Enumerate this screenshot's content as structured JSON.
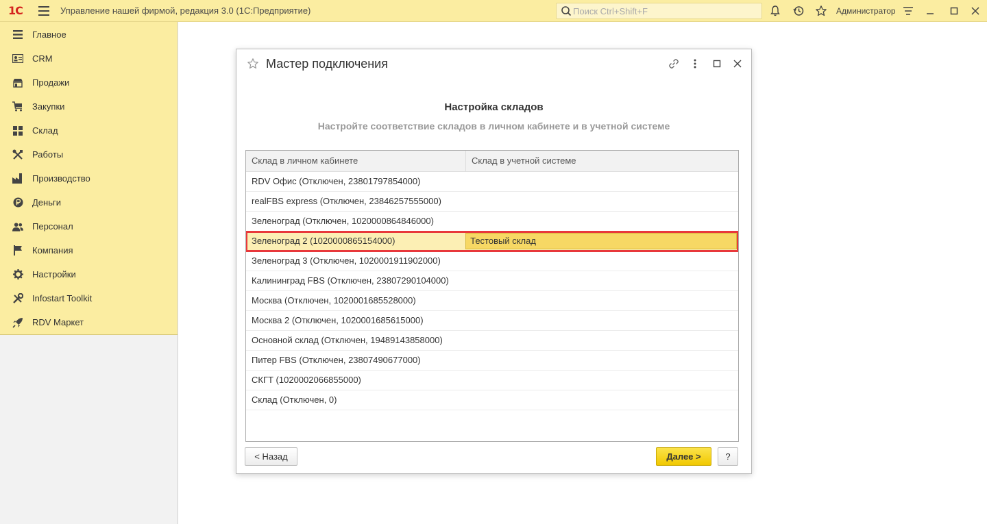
{
  "topbar": {
    "logo_text": "1С",
    "app_title": "Управление нашей фирмой, редакция 3.0  (1С:Предприятие)",
    "search_placeholder": "Поиск Ctrl+Shift+F",
    "user": "Администратор"
  },
  "sidebar": {
    "items": [
      {
        "label": "Главное",
        "icon": "menu-icon"
      },
      {
        "label": "CRM",
        "icon": "contact-card-icon"
      },
      {
        "label": "Продажи",
        "icon": "shop-icon"
      },
      {
        "label": "Закупки",
        "icon": "cart-icon"
      },
      {
        "label": "Склад",
        "icon": "warehouse-grid-icon"
      },
      {
        "label": "Работы",
        "icon": "tools-icon"
      },
      {
        "label": "Производство",
        "icon": "factory-icon"
      },
      {
        "label": "Деньги",
        "icon": "ruble-coin-icon"
      },
      {
        "label": "Персонал",
        "icon": "people-icon"
      },
      {
        "label": "Компания",
        "icon": "flag-icon"
      },
      {
        "label": "Настройки",
        "icon": "gear-icon"
      },
      {
        "label": "Infostart Toolkit",
        "icon": "wrench-icon"
      },
      {
        "label": "RDV Маркет",
        "icon": "rocket-icon"
      }
    ]
  },
  "dialog": {
    "title": "Мастер подключения",
    "heading": "Настройка складов",
    "subheading": "Настройте соответствие складов в личном кабинете и в учетной системе",
    "columns": [
      "Склад в личном кабинете",
      "Склад в учетной системе"
    ],
    "rows": [
      {
        "cabinet": "RDV Офис (Отключен, 23801797854000)",
        "system": ""
      },
      {
        "cabinet": "realFBS express (Отключен, 23846257555000)",
        "system": ""
      },
      {
        "cabinet": "Зеленоград (Отключен, 1020000864846000)",
        "system": ""
      },
      {
        "cabinet": "Зеленоград 2 (1020000865154000)",
        "system": "Тестовый склад"
      },
      {
        "cabinet": "Зеленоград 3 (Отключен, 1020001911902000)",
        "system": ""
      },
      {
        "cabinet": "Калининград FBS (Отключен, 23807290104000)",
        "system": ""
      },
      {
        "cabinet": "Москва (Отключен, 1020001685528000)",
        "system": ""
      },
      {
        "cabinet": "Москва 2 (Отключен, 1020001685615000)",
        "system": ""
      },
      {
        "cabinet": "Основной склад (Отключен, 19489143858000)",
        "system": ""
      },
      {
        "cabinet": "Питер FBS (Отключен, 23807490677000)",
        "system": ""
      },
      {
        "cabinet": "СКГТ (1020002066855000)",
        "system": ""
      },
      {
        "cabinet": "Склад (Отключен, 0)",
        "system": ""
      }
    ],
    "selected_row_index": 3,
    "back_label": "< Назад",
    "next_label": "Далее >",
    "help_label": "?"
  },
  "colors": {
    "topbar_bg": "#fbeda1",
    "sidebar_bg": "#fbeda1",
    "accent_yellow": "#f1c800",
    "highlight_red": "#e8383b",
    "logo_red": "#d4231e"
  }
}
